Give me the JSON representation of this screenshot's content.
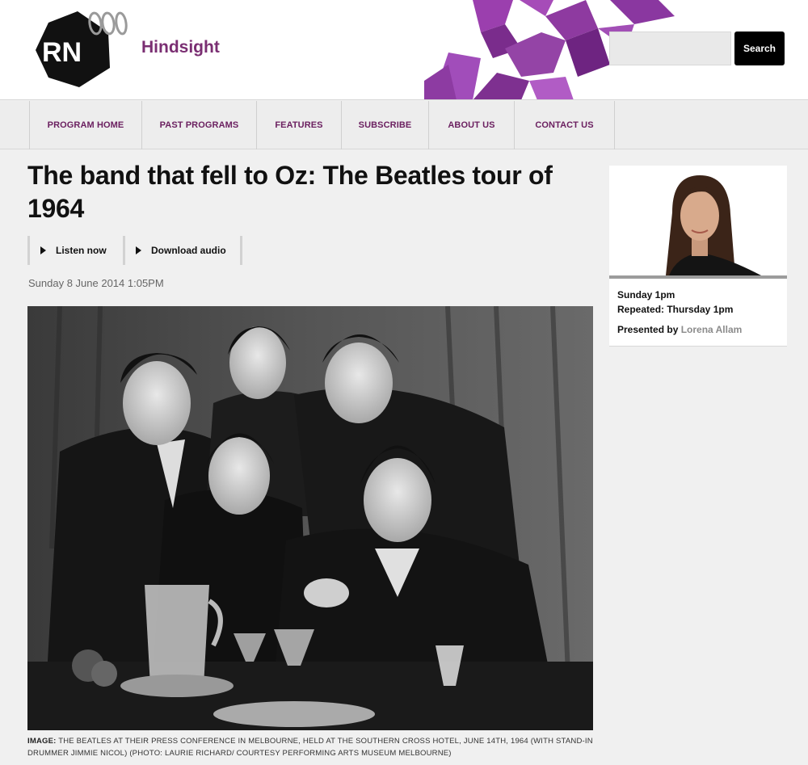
{
  "header": {
    "network_logo": "RN",
    "program_name": "Hindsight",
    "search": {
      "placeholder": "",
      "button_label": "Search"
    }
  },
  "nav": {
    "items": [
      {
        "label": "PROGRAM HOME"
      },
      {
        "label": "PAST PROGRAMS"
      },
      {
        "label": "FEATURES"
      },
      {
        "label": "SUBSCRIBE"
      },
      {
        "label": "ABOUT US"
      },
      {
        "label": "CONTACT US"
      }
    ]
  },
  "article": {
    "title": "The band that fell to Oz: The Beatles tour of 1964",
    "listen_label": "Listen now",
    "download_label": "Download audio",
    "date": "Sunday 8 June 2014 1:05PM",
    "caption_label": "IMAGE:",
    "caption_text": "THE BEATLES AT THEIR PRESS CONFERENCE IN MELBOURNE, HELD AT THE SOUTHERN CROSS HOTEL, JUNE 14TH, 1964 (WITH STAND-IN DRUMMER JIMMIE NICOL) (PHOTO: LAURIE RICHARD/ COURTESY PERFORMING ARTS MUSEUM MELBOURNE)"
  },
  "sidebar": {
    "schedule_primary": "Sunday 1pm",
    "schedule_repeat": "Repeated: Thursday 1pm",
    "presented_by_label": "Presented by",
    "presenter_name": "Lorena Allam"
  },
  "colors": {
    "brand_purple": "#7a2e72",
    "nav_text": "#6b2060",
    "banner_purple": "#8e3aa0",
    "search_button": "#000000"
  }
}
